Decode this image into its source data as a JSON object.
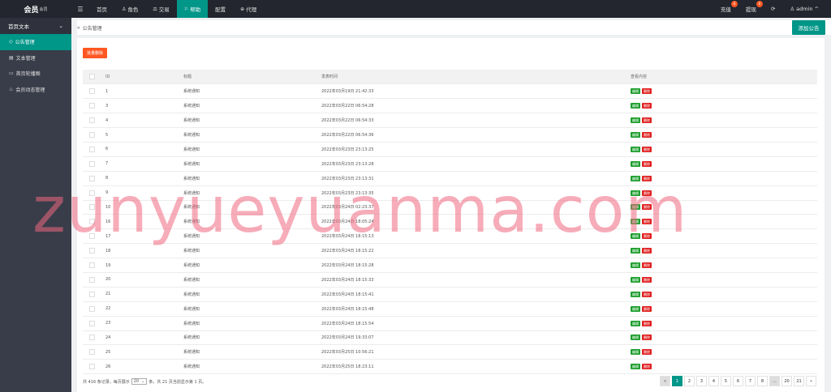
{
  "topbar": {
    "logo": "会员",
    "logo_sup": "会员",
    "menu_icon": "☰",
    "nav": [
      {
        "label": "首页",
        "icon": "",
        "active": false
      },
      {
        "label": "角色",
        "icon": "♙",
        "active": false
      },
      {
        "label": "交易",
        "icon": "⚖",
        "active": false
      },
      {
        "label": "帮助",
        "icon": "⚐",
        "active": true
      },
      {
        "label": "配置",
        "icon": "",
        "active": false
      },
      {
        "label": "代理",
        "icon": "⊕",
        "active": false
      }
    ],
    "right": {
      "recharge_label": "充值",
      "recharge_badge": "0",
      "withdraw_label": "提现",
      "withdraw_badge": "0",
      "refresh_icon": "⟳",
      "user_icon": "♙",
      "user_label": "admin",
      "user_caret": "^"
    }
  },
  "sidebar": {
    "group_label": "首页文本",
    "group_caret": "⌄",
    "items": [
      {
        "label": "公告管理",
        "icon": "◇",
        "active": true
      },
      {
        "label": "文本管理",
        "icon": "▤",
        "active": false
      },
      {
        "label": "首页轮播图",
        "icon": "▭",
        "active": false
      },
      {
        "label": "会员动态管理",
        "icon": "♨",
        "active": false
      }
    ]
  },
  "header": {
    "crumb_icon": "»",
    "crumb": "公告管理",
    "add_button": "添加公告"
  },
  "toolbar": {
    "batch_delete": "批量删除"
  },
  "table": {
    "columns": [
      "ID",
      "标题",
      "发表时间",
      "查看内容"
    ],
    "edit_label": "编辑",
    "delete_label": "删除",
    "rows": [
      {
        "id": "1",
        "title": "系统通知",
        "time": "2022年03月19日 21:42:33"
      },
      {
        "id": "3",
        "title": "系统通知",
        "time": "2022年03月22日 06:54:28"
      },
      {
        "id": "4",
        "title": "系统通知",
        "time": "2022年03月22日 06:54:33"
      },
      {
        "id": "5",
        "title": "系统通知",
        "time": "2022年03月22日 06:54:36"
      },
      {
        "id": "6",
        "title": "系统通知",
        "time": "2022年03月23日 23:13:25"
      },
      {
        "id": "7",
        "title": "系统通知",
        "time": "2022年03月23日 23:13:28"
      },
      {
        "id": "8",
        "title": "系统通知",
        "time": "2022年03月23日 23:13:31"
      },
      {
        "id": "9",
        "title": "系统通知",
        "time": "2022年03月23日 23:13:35"
      },
      {
        "id": "10",
        "title": "系统通知",
        "time": "2022年03月24日 02:23:37"
      },
      {
        "id": "16",
        "title": "系统通知",
        "time": "2022年03月24日 18:05:24"
      },
      {
        "id": "17",
        "title": "系统通知",
        "time": "2022年03月24日 18:15:13"
      },
      {
        "id": "18",
        "title": "系统通知",
        "time": "2022年03月24日 18:15:22"
      },
      {
        "id": "19",
        "title": "系统通知",
        "time": "2022年03月24日 18:15:28"
      },
      {
        "id": "20",
        "title": "系统通知",
        "time": "2022年03月24日 18:15:33"
      },
      {
        "id": "21",
        "title": "系统通知",
        "time": "2022年03月24日 18:15:41"
      },
      {
        "id": "22",
        "title": "系统通知",
        "time": "2022年03月24日 18:15:48"
      },
      {
        "id": "23",
        "title": "系统通知",
        "time": "2022年03月24日 18:15:54"
      },
      {
        "id": "24",
        "title": "系统通知",
        "time": "2022年03月24日 19:33:07"
      },
      {
        "id": "25",
        "title": "系统通知",
        "time": "2022年03月25日 10:56:21"
      },
      {
        "id": "26",
        "title": "系统通知",
        "time": "2022年03月25日 18:23:11"
      }
    ]
  },
  "footer": {
    "info_prefix": "共 416 条记录，每页展示",
    "page_size": "20",
    "info_suffix": "条，共 21 页当前显示第 1 页。",
    "pages": [
      "«",
      "1",
      "2",
      "3",
      "4",
      "5",
      "6",
      "7",
      "8",
      "...",
      "20",
      "21",
      "»"
    ],
    "active_page": "1"
  },
  "watermark": "zunyueyuanma.com",
  "colors": {
    "accent": "#009688",
    "danger": "#ff5722",
    "sidebar_bg": "#393d49",
    "topbar_bg": "#23262e"
  }
}
